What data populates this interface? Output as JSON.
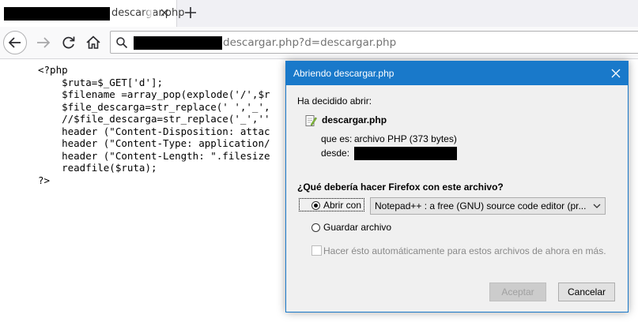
{
  "browser": {
    "tab": {
      "title": "descargar.php"
    },
    "url": {
      "visible_text": "descargar.php?d=descargar.php"
    }
  },
  "page": {
    "source_lines": [
      "<?php",
      "    $ruta=$_GET['d'];",
      "    $filename =array_pop(explode('/',$r",
      "    $file_descarga=str_replace(' ','_',",
      "    //$file_descarga=str_replace('_',''",
      "    header (\"Content-Disposition: attac",
      "    header (\"Content-Type: application/",
      "    header (\"Content-Length: \".filesize",
      "    readfile($ruta);",
      "?>"
    ]
  },
  "dialog": {
    "title": "Abriendo descargar.php",
    "intro": "Ha decidido abrir:",
    "file_name": "descargar.php",
    "type_label": "que es:",
    "type_value": "archivo PHP (373 bytes)",
    "from_label": "desde:",
    "question": "¿Qué debería hacer Firefox con este archivo?",
    "open_with_label": "Abrir con",
    "open_with_app": "Notepad++ : a free (GNU) source code editor (pr...",
    "save_file_label": "Guardar archivo",
    "auto_label": "Hacer ésto automáticamente para estos archivos de ahora en más.",
    "accept_button": "Aceptar",
    "cancel_button": "Cancelar"
  },
  "colors": {
    "dialog_titlebar": "#1979ca",
    "dialog_background": "#f0f0f0"
  }
}
